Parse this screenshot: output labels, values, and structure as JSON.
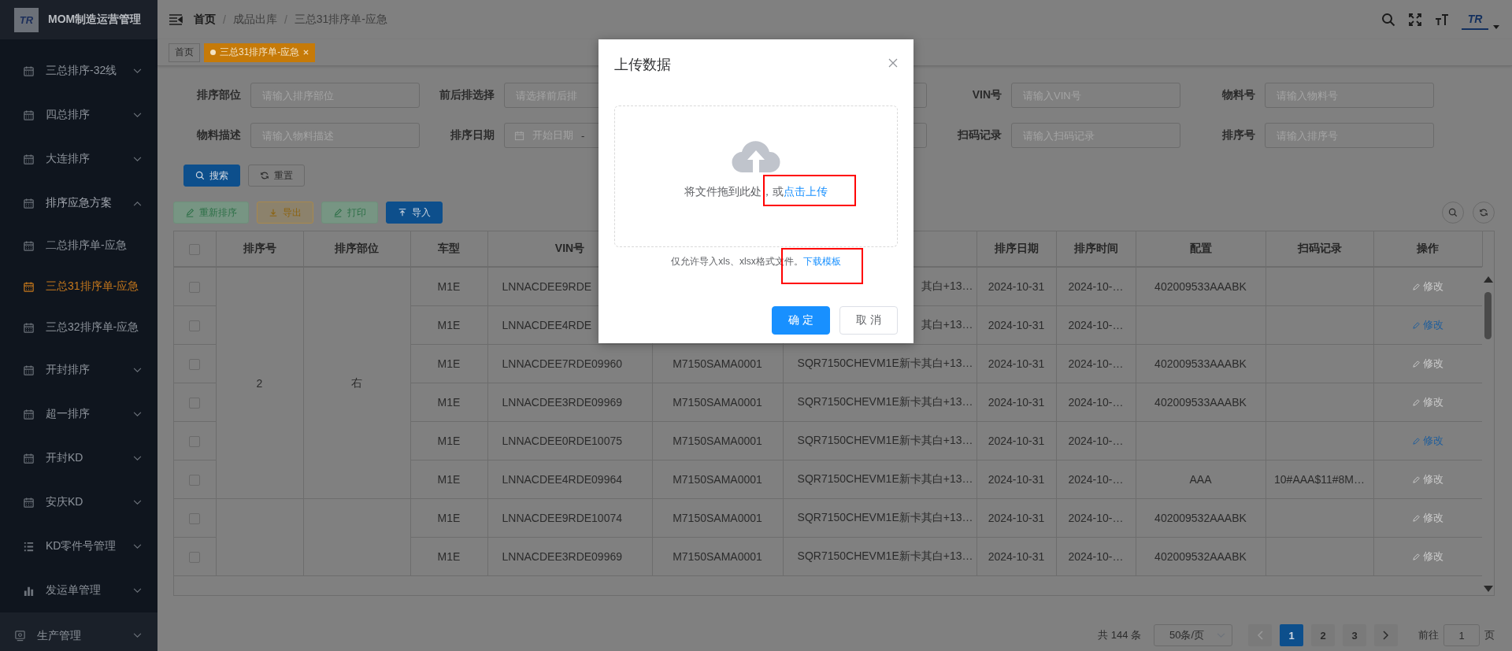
{
  "app": {
    "logo_text": "TR",
    "title": "MOM制造运营管理"
  },
  "sidebar": {
    "items": [
      {
        "label": "三总排序-32线",
        "kind": "calendar",
        "expanded": false
      },
      {
        "label": "四总排序",
        "kind": "calendar",
        "expanded": false
      },
      {
        "label": "大连排序",
        "kind": "calendar",
        "expanded": false
      },
      {
        "label": "排序应急方案",
        "kind": "calendar",
        "expanded": true,
        "children": [
          {
            "label": "二总排序单-应急",
            "selected": false
          },
          {
            "label": "三总31排序单-应急",
            "selected": true
          },
          {
            "label": "三总32排序单-应急",
            "selected": false
          }
        ]
      },
      {
        "label": "开封排序",
        "kind": "calendar",
        "expanded": false
      },
      {
        "label": "超一排序",
        "kind": "calendar",
        "expanded": false
      },
      {
        "label": "开封KD",
        "kind": "calendar",
        "expanded": false
      },
      {
        "label": "安庆KD",
        "kind": "calendar",
        "expanded": false
      },
      {
        "label": "KD零件号管理",
        "kind": "list",
        "expanded": false
      },
      {
        "label": "发运单管理",
        "kind": "chart",
        "expanded": false
      }
    ],
    "footer_item": {
      "label": "生产管理",
      "kind": "chip",
      "expanded": false
    }
  },
  "header": {
    "separator": "/",
    "breadcrumb": [
      {
        "label": "首页",
        "link": true
      },
      {
        "label": "成品出库",
        "link": false
      },
      {
        "label": "三总31排序单-应急",
        "link": false
      }
    ],
    "avatar_text": "TR"
  },
  "tags": [
    {
      "label": "首页",
      "selected": false
    },
    {
      "label": "三总31排序单-应急",
      "selected": true
    }
  ],
  "filters": [
    [
      {
        "label": "排序部位",
        "kind": "text",
        "placeholder": "请输入排序部位"
      },
      {
        "label": "前后排选择",
        "kind": "text",
        "placeholder": "请选择前后排"
      },
      {
        "kind": "text"
      },
      {
        "label": "VIN号",
        "kind": "text",
        "placeholder": "请输入VIN号"
      },
      {
        "label": "物料号",
        "kind": "text",
        "placeholder": "请输入物料号"
      }
    ],
    [
      {
        "label": "物料描述",
        "kind": "text",
        "placeholder": "请输入物料描述"
      },
      {
        "label": "排序日期",
        "kind": "date_range",
        "placeholder": "开始日期",
        "separator": "-"
      },
      {
        "kind": "text"
      },
      {
        "label": "扫码记录",
        "kind": "text",
        "placeholder": "请输入扫码记录"
      },
      {
        "label": "排序号",
        "kind": "text",
        "placeholder": "请输入排序号"
      }
    ]
  ],
  "search_buttons": [
    {
      "label": "搜索",
      "kind": "search"
    },
    {
      "label": "重置",
      "kind": "reset"
    }
  ],
  "toolbar": [
    {
      "label": "重新排序",
      "kind": "resort"
    },
    {
      "label": "导出",
      "kind": "export"
    },
    {
      "label": "打印",
      "kind": "print"
    },
    {
      "label": "导入",
      "kind": "import"
    }
  ],
  "table": {
    "header_checked": false,
    "columns": [
      "排序号",
      "排序部位",
      "车型",
      "VIN号",
      null,
      null,
      "排序日期",
      "排序时间",
      "配置",
      "扫码记录",
      "操作"
    ],
    "groups": [
      {
        "seq": "2",
        "side": "右",
        "rows": [
          {
            "checked": false,
            "cells": [
              "M1E",
              "LNNACDEE9RDE",
              null,
              "其白+13…",
              "2024-10-31",
              "2024-10-…",
              "402009533AAABK",
              null
            ],
            "action": {
              "label": "修改",
              "disabled": true
            }
          },
          {
            "checked": false,
            "cells": [
              "M1E",
              "LNNACDEE4RDE",
              null,
              "其白+13…",
              "2024-10-31",
              "2024-10-…",
              null,
              null
            ],
            "action": {
              "label": "修改",
              "disabled": false
            }
          },
          {
            "checked": false,
            "cells": [
              "M1E",
              "LNNACDEE7RDE09960",
              "M7150SAMA0001",
              "SQR7150CHEVM1E新卡其白+13…",
              "2024-10-31",
              "2024-10-…",
              "402009533AAABK",
              null
            ],
            "action": {
              "label": "修改",
              "disabled": true
            }
          },
          {
            "checked": false,
            "cells": [
              "M1E",
              "LNNACDEE3RDE09969",
              "M7150SAMA0001",
              "SQR7150CHEVM1E新卡其白+13…",
              "2024-10-31",
              "2024-10-…",
              "402009533AAABK",
              null
            ],
            "action": {
              "label": "修改",
              "disabled": true
            }
          },
          {
            "checked": false,
            "cells": [
              "M1E",
              "LNNACDEE0RDE10075",
              "M7150SAMA0001",
              "SQR7150CHEVM1E新卡其白+13…",
              "2024-10-31",
              "2024-10-…",
              null,
              null
            ],
            "action": {
              "label": "修改",
              "disabled": false
            }
          },
          {
            "checked": false,
            "cells": [
              "M1E",
              "LNNACDEE4RDE09964",
              "M7150SAMA0001",
              "SQR7150CHEVM1E新卡其白+13…",
              "2024-10-31",
              "2024-10-…",
              "AAA",
              "10#AAA$11#8M…"
            ],
            "action": {
              "label": "修改",
              "disabled": true
            }
          }
        ]
      },
      {
        "rows": [
          {
            "checked": false,
            "cells": [
              "M1E",
              "LNNACDEE9RDE10074",
              "M7150SAMA0001",
              "SQR7150CHEVM1E新卡其白+13…",
              "2024-10-31",
              "2024-10-…",
              "402009532AAABK",
              null
            ],
            "action": {
              "label": "修改",
              "disabled": true
            }
          },
          {
            "checked": false,
            "cells": [
              "M1E",
              "LNNACDEE3RDE09969",
              "M7150SAMA0001",
              "SQR7150CHEVM1E新卡其白+13…",
              "2024-10-31",
              "2024-10-…",
              "402009532AAABK",
              null
            ],
            "action": {
              "label": "修改",
              "disabled": true
            }
          }
        ]
      }
    ]
  },
  "pagination": {
    "total": "共 144 条",
    "page_size": "50条/页",
    "prev_disabled": true,
    "next_disabled": false,
    "pages": [
      {
        "label": "1",
        "selected": true
      },
      {
        "label": "2",
        "selected": false
      },
      {
        "label": "3",
        "selected": false
      }
    ],
    "goto_label": "前往",
    "goto_value": "1",
    "goto_suffix": "页"
  },
  "dialog": {
    "title": "上传数据",
    "drop_text": "将文件拖到此处，或",
    "upload_link": {
      "label": "点击上传",
      "highlighted": true
    },
    "tip": "仅允许导入xls、xlsx格式文件。",
    "template_link": {
      "label": "下载模板",
      "highlighted": true
    },
    "buttons": [
      {
        "label": "确 定",
        "kind": "confirm"
      },
      {
        "label": "取 消",
        "kind": "cancel"
      }
    ]
  }
}
